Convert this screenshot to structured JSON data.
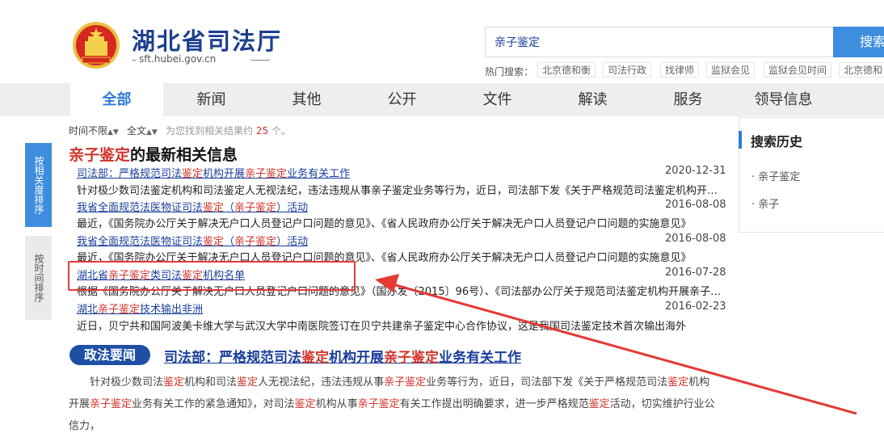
{
  "header": {
    "site_title": "湖北省司法厅",
    "site_domain": "sft.hubei.gov.cn",
    "search_value": "亲子鉴定",
    "search_button": "搜索",
    "hot_label": "热门搜索：",
    "hot_tags": [
      "北京德和衡",
      "司法行政",
      "找律师",
      "监狱会见",
      "监狱会见时间",
      "北京德和"
    ]
  },
  "nav": {
    "tabs": [
      "全部",
      "新闻",
      "其他",
      "公开",
      "文件",
      "解读",
      "服务",
      "领导信息"
    ],
    "active": "全部"
  },
  "filters": {
    "time": "时间不限",
    "scope": "全文",
    "count_prefix": "为您找到相关结果约",
    "count": "25",
    "count_suffix": "个。"
  },
  "sort": {
    "relevance": "按相关度排序",
    "time": "按时间排序"
  },
  "section": {
    "keyword": "亲子鉴定",
    "rest": "的最新相关信息"
  },
  "results": [
    {
      "title": "司法部：严格规范司法鉴定机构开展亲子鉴定业务有关工作",
      "date": "2020-12-31",
      "snippet": "针对极少数司法鉴定机构和司法鉴定人无视法纪，违法违规从事亲子鉴定业务等行为，近日，司法部下发《关于严格规范司法鉴定机构开展亲子鉴定业务有关工作的紧急通知》"
    },
    {
      "title": "我省全面规范法医物证司法鉴定（亲子鉴定）活动",
      "date": "2016-08-08",
      "snippet": "最近，《国务院办公厅关于解决无户口人员登记户口问题的意见》、《省人民政府办公厅关于解决无户口人员登记户口问题的实施意见》"
    },
    {
      "title": "我省全面规范法医物证司法鉴定（亲子鉴定）活动",
      "date": "2016-08-08",
      "snippet": "最近，《国务院办公厅关于解决无户口人员登记户口问题的意见》、《省人民政府办公厅关于解决无户口人员登记户口问题的实施意见》"
    },
    {
      "title": "湖北省亲子鉴定类司法鉴定机构名单",
      "date": "2016-07-28",
      "snippet": "根据《国务院办公厅关于解决无户口人员登记户口问题的意见》（国办发〔2015〕96号）、《司法部办公厅关于规范司法鉴定机构开展亲子鉴定业务有关工作的通知》"
    },
    {
      "title": "湖北亲子鉴定技术输出非洲",
      "date": "2016-02-23",
      "snippet": "近日，贝宁共和国阿波美卡维大学与武汉大学中南医院签订在贝宁共建亲子鉴定中心合作协议，这是我国司法鉴定技术首次输出海外"
    }
  ],
  "news": {
    "badge": "政法要闻",
    "title": "司法部：严格规范司法鉴定机构开展亲子鉴定业务有关工作",
    "body": "针对极少数司法鉴定机构和司法鉴定人无视法纪，违法违规从事亲子鉴定业务等行为，近日，司法部下发《关于严格规范司法鉴定机构开展亲子鉴定业务有关工作的紧急通知》，对司法鉴定机构从事亲子鉴定有关工作提出明确要求，进一步严格规范鉴定活动，切实维护行业公信力，"
  },
  "sidebar": {
    "title": "搜索历史",
    "items": [
      "亲子鉴定",
      "亲子"
    ]
  },
  "colors": {
    "brand": "#1d3f8e",
    "accent": "#3e8ddf",
    "highlight": "#d0342c",
    "annotation": "#e53935"
  }
}
